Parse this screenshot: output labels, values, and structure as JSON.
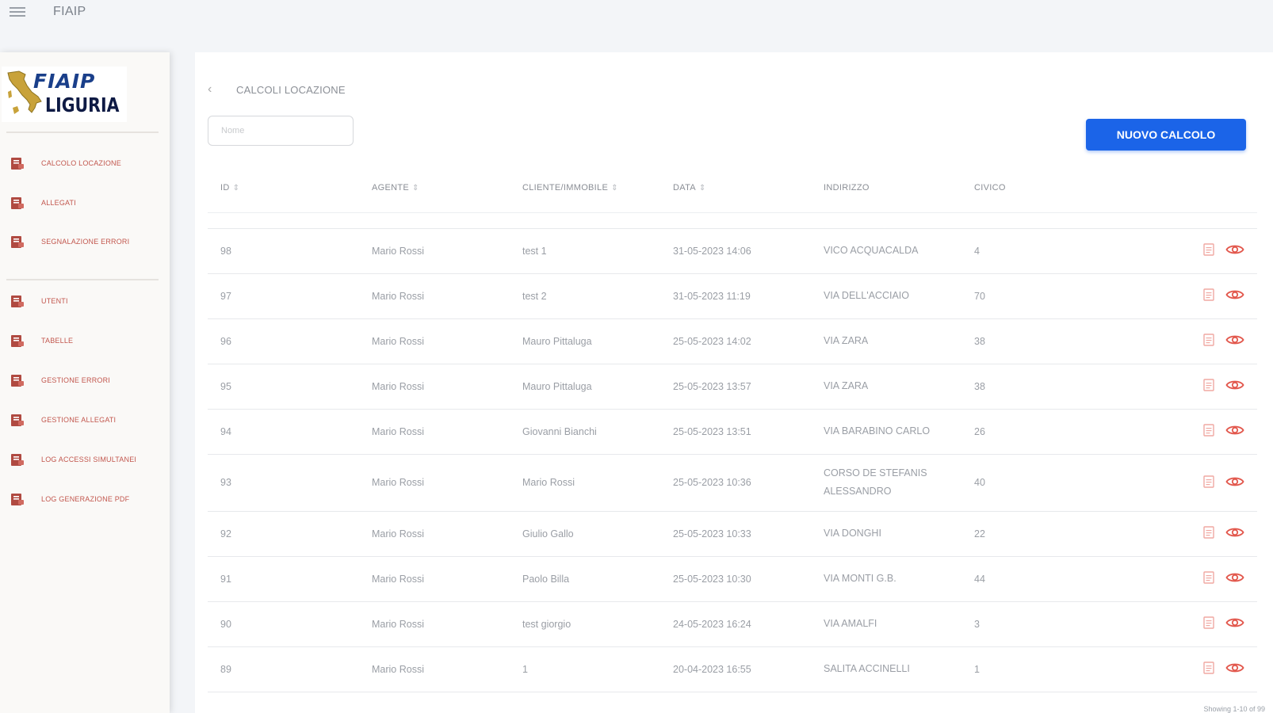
{
  "topbar": {
    "title": "FIAIP"
  },
  "logo": {
    "line1": "FIAIP",
    "line2": "LIGURIA"
  },
  "sidebar": {
    "group1": [
      {
        "label": "CALCOLO LOCAZIONE",
        "icon": "document-icon"
      },
      {
        "label": "ALLEGATI",
        "icon": "document-icon"
      },
      {
        "label": "SEGNALAZIONE ERRORI",
        "icon": "document-icon"
      }
    ],
    "group2": [
      {
        "label": "UTENTI",
        "icon": "document-icon"
      },
      {
        "label": "TABELLE",
        "icon": "document-icon"
      },
      {
        "label": "GESTIONE ERRORI",
        "icon": "document-icon"
      },
      {
        "label": "GESTIONE ALLEGATI",
        "icon": "document-icon"
      },
      {
        "label": "LOG ACCESSI SIMULTANEI",
        "icon": "document-icon"
      },
      {
        "label": "LOG GENERAZIONE PDF",
        "icon": "document-icon"
      }
    ]
  },
  "page": {
    "breadcrumb": "CALCOLI LOCAZIONE",
    "search_placeholder": "Nome",
    "new_button": "NUOVO CALCOLO",
    "footer": "Showing 1-10 of 99"
  },
  "table": {
    "columns": [
      {
        "label": "ID",
        "sort": "⇕"
      },
      {
        "label": "AGENTE",
        "sort": "⇕"
      },
      {
        "label": "CLIENTE/IMMOBILE",
        "sort": "⇕"
      },
      {
        "label": "DATA",
        "sort": "⇕"
      },
      {
        "label": "INDIRIZZO",
        "sort": ""
      },
      {
        "label": "CIVICO",
        "sort": ""
      }
    ],
    "rows": [
      {
        "id": "98",
        "agente": "Mario Rossi",
        "cliente": "test 1",
        "data": "31-05-2023 14:06",
        "indirizzo": "VICO ACQUACALDA",
        "civico": "4"
      },
      {
        "id": "97",
        "agente": "Mario Rossi",
        "cliente": "test 2",
        "data": "31-05-2023 11:19",
        "indirizzo": "VIA DELL'ACCIAIO",
        "civico": "70"
      },
      {
        "id": "96",
        "agente": "Mario Rossi",
        "cliente": "Mauro Pittaluga",
        "data": "25-05-2023 14:02",
        "indirizzo": "VIA ZARA",
        "civico": "38"
      },
      {
        "id": "95",
        "agente": "Mario Rossi",
        "cliente": "Mauro Pittaluga",
        "data": "25-05-2023 13:57",
        "indirizzo": "VIA ZARA",
        "civico": "38"
      },
      {
        "id": "94",
        "agente": "Mario Rossi",
        "cliente": "Giovanni Bianchi",
        "data": "25-05-2023 13:51",
        "indirizzo": "VIA BARABINO CARLO",
        "civico": "26"
      },
      {
        "id": "93",
        "agente": "Mario Rossi",
        "cliente": "Mario Rossi",
        "data": "25-05-2023 10:36",
        "indirizzo": "CORSO DE STEFANIS ALESSANDRO",
        "civico": "40"
      },
      {
        "id": "92",
        "agente": "Mario Rossi",
        "cliente": "Giulio Gallo",
        "data": "25-05-2023 10:33",
        "indirizzo": "VIA DONGHI",
        "civico": "22"
      },
      {
        "id": "91",
        "agente": "Mario Rossi",
        "cliente": "Paolo Billa",
        "data": "25-05-2023 10:30",
        "indirizzo": "VIA MONTI G.B.",
        "civico": "44"
      },
      {
        "id": "90",
        "agente": "Mario Rossi",
        "cliente": "test giorgio",
        "data": "24-05-2023 16:24",
        "indirizzo": "VIA AMALFI",
        "civico": "3"
      },
      {
        "id": "89",
        "agente": "Mario Rossi",
        "cliente": "1",
        "data": "20-04-2023 16:55",
        "indirizzo": "SALITA ACCINELLI",
        "civico": "1"
      }
    ],
    "action_icons": [
      "pdf-icon",
      "eye-icon"
    ]
  },
  "colors": {
    "accent": "#1b64e8",
    "nav_text": "#c2574e",
    "action_icon": "#e2574c"
  }
}
